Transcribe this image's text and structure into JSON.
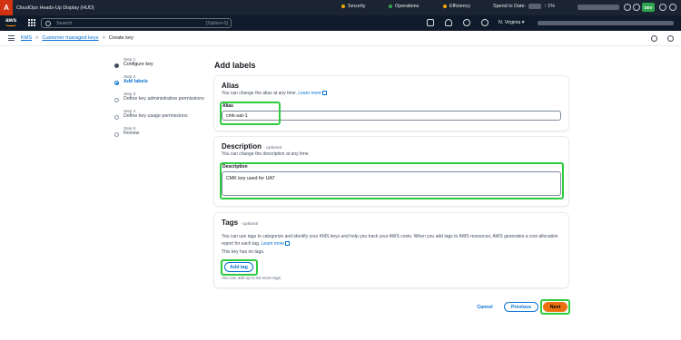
{
  "hud": {
    "title": "CloudOps Heads-Up Display (HUD)",
    "security": "Security",
    "operations": "Operations",
    "efficiency": "Efficiency",
    "spend": "Spend to Date:",
    "spend_value": "↑ 1%",
    "env": "DEV"
  },
  "nav": {
    "logo": "aws",
    "search_placeholder": "Search",
    "search_shortcut": "[Option+S]",
    "region": "N. Virginia ▾"
  },
  "breadcrumb": {
    "kms": "KMS",
    "cmk": "Customer managed keys",
    "current": "Create key",
    "sep": ">"
  },
  "steps": [
    {
      "num": "Step 1",
      "label": "Configure key",
      "state": "done"
    },
    {
      "num": "Step 2",
      "label": "Add labels",
      "state": "current"
    },
    {
      "num": "Step 3",
      "label": "Define key administrative permissions",
      "state": "off"
    },
    {
      "num": "Step 4",
      "label": "Define key usage permissions",
      "state": "off"
    },
    {
      "num": "Step 5",
      "label": "Review",
      "state": "off"
    }
  ],
  "page": {
    "title": "Add labels"
  },
  "alias": {
    "heading": "Alias",
    "desc": "You can change the alias at any time.",
    "learn": "Learn more",
    "field_label": "Alias",
    "value": "cmk-uat-1"
  },
  "description": {
    "heading": "Description",
    "optional": "- optional",
    "desc": "You can change the description at any time.",
    "field_label": "Description",
    "value": "CMK key used for UAT"
  },
  "tags": {
    "heading": "Tags",
    "optional": "- optional",
    "desc": "You can use tags to categorize and identify your KMS keys and help you track your AWS costs. When you add tags to AWS resources, AWS generates a cost allocation report for each tag.",
    "learn": "Learn more",
    "none": "This key has no tags.",
    "add": "Add tag",
    "limit": "You can add up to 50 more tags."
  },
  "footer": {
    "cancel": "Cancel",
    "previous": "Previous",
    "next": "Next"
  },
  "colors": {
    "highlight": "#2ecc40",
    "primary": "#ec7211",
    "link": "#0972d3"
  }
}
